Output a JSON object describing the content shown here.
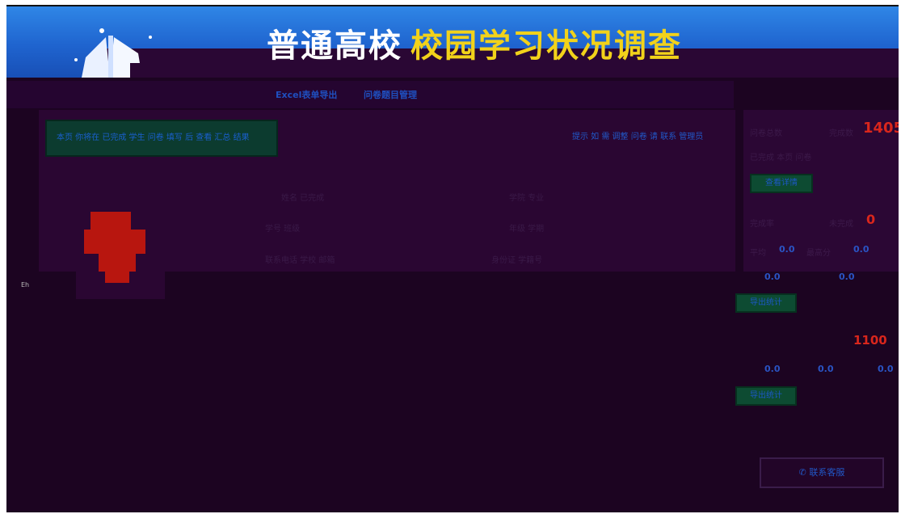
{
  "header": {
    "title_white": "普通高校",
    "title_yellow": "校园学习状况调查"
  },
  "nav": {
    "tabs": [
      "Excel表单导出",
      "问卷题目管理"
    ]
  },
  "notice": {
    "text": "本页 你将在 已完成 学生 问卷 填写 后 查看 汇总 结果",
    "tip": "提示 如 需 调整 问卷 请 联系 管理员"
  },
  "profile": {
    "fields": [
      {
        "label": "姓名 已完成"
      },
      {
        "label": "学院 专业"
      },
      {
        "label": "学号 班级"
      },
      {
        "label": "年级 学期"
      },
      {
        "label": "联系电话 学校 邮箱"
      },
      {
        "label": "身份证 学籍号"
      }
    ]
  },
  "right": {
    "total_label": "问卷总数",
    "total_sub": "完成数",
    "total_value": "1405",
    "line2": "已完成 本页 问卷",
    "btn1": "查看详情",
    "pct_label": "完成率",
    "pct_sub": "未完成",
    "pct_value": "0",
    "stat_a_label": "平均",
    "stat_a_value": "0.0",
    "stat_b_label": "最高分",
    "stat_b_value": "0.0",
    "stat_c_value": "0.0",
    "stat_d_value": "0.0",
    "btn2": "导出统计",
    "count_value": "1100",
    "stat_e_value": "0.0",
    "stat_f_value": "0.0",
    "stat_g_value": "0.0",
    "btn3": "导出统计",
    "phone_label": "联系客服"
  },
  "misc": {
    "tiny": "Eh"
  }
}
